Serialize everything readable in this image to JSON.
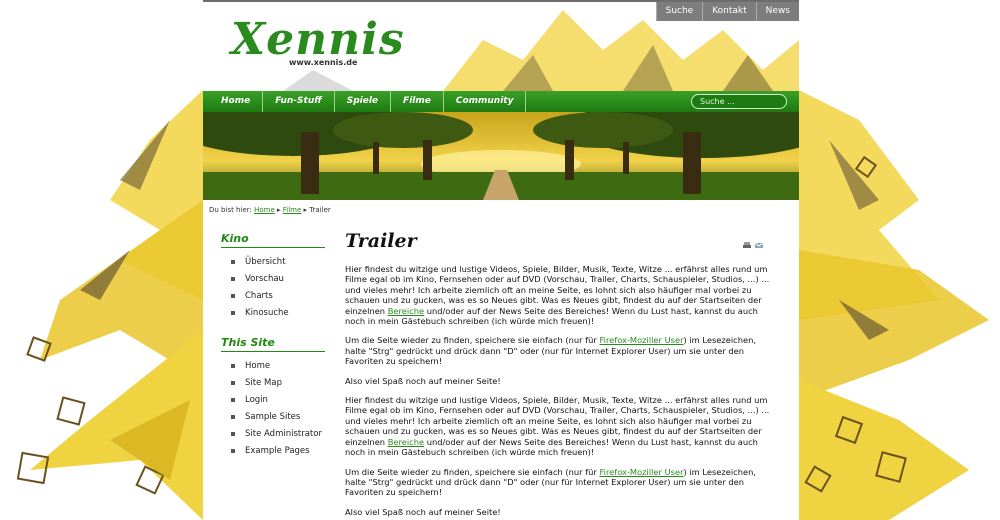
{
  "toplinks": [
    "Suche",
    "Kontakt",
    "News"
  ],
  "logo": {
    "text": "Xennis",
    "url": "www.xennis.de"
  },
  "nav": [
    "Home",
    "Fun-Stuff",
    "Spiele",
    "Filme",
    "Community"
  ],
  "search": {
    "placeholder": "Suche ..."
  },
  "breadcrumb": {
    "prefix": "Du bist hier:",
    "items": [
      "Home",
      "Filme",
      "Trailer"
    ]
  },
  "sidebar": [
    {
      "title": "Kino",
      "items": [
        "Übersicht",
        "Vorschau",
        "Charts",
        "Kinosuche"
      ]
    },
    {
      "title": "This Site",
      "items": [
        "Home",
        "Site Map",
        "Login",
        "Sample Sites",
        "Site Administrator",
        "Example Pages"
      ]
    }
  ],
  "content": {
    "title": "Trailer",
    "tools": [
      "print-icon",
      "email-icon"
    ],
    "p1a": "Hier findest du witzige und lustige Videos, Spiele, Bilder, Musik, Texte, Witze ... erfährst alles rund um Filme egal ob im Kino, Fernsehen oder auf DVD (Vorschau, Trailer, Charts, Schauspieler, Studios, ...) ... und vieles mehr! Ich arbeite ziemlich oft an meine Seite, es lohnt sich also häufiger mal vorbei zu schauen und zu gucken, was es so Neues gibt. Was es Neues gibt, findest du auf der Startseiten der einzelnen ",
    "p1link": "Bereiche",
    "p1b": " und/oder auf der News Seite des Bereiches! Wenn du Lust hast, kannst du auch noch in mein Gästebuch schreiben (ich würde mich freuen)!",
    "p2a": "Um die Seite wieder zu finden, speichere sie einfach (nur für ",
    "p2link": "Firefox-Moziller User",
    "p2b": ") im Lesezeichen, halte \"Strg\" gedrückt und drück dann \"D\" oder (nur für Internet Explorer User) um sie unter den Favoriten zu speichern!",
    "p3": "Also viel Spaß noch auf meiner Seite!"
  },
  "colors": {
    "accent": "#2a8a1e",
    "nav": "#1e7a12",
    "toplink": "#7d7d7d"
  }
}
